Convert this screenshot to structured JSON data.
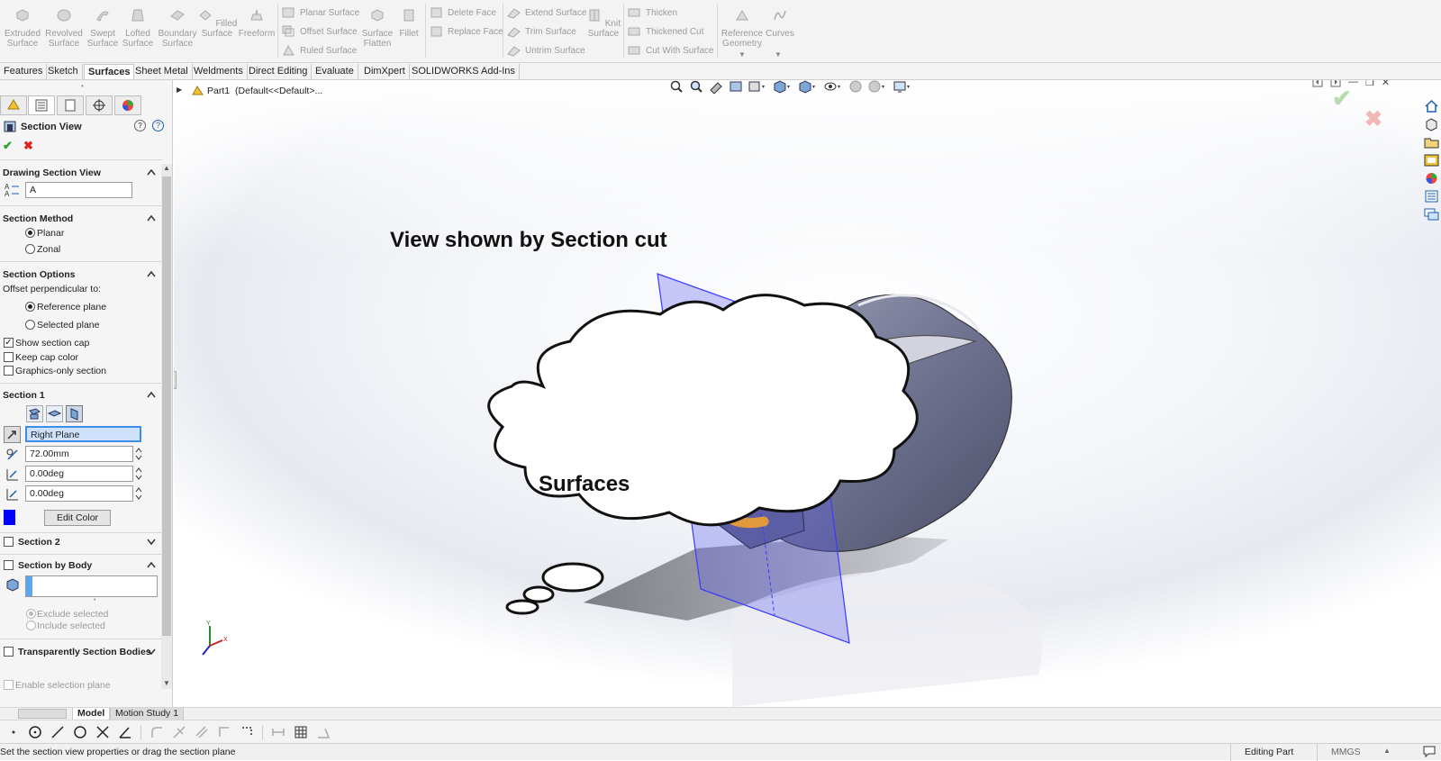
{
  "ribbon": {
    "big_buttons": [
      {
        "id": "extruded",
        "label": "Extruded Surface",
        "icon": "extruded-surface-icon"
      },
      {
        "id": "revolved",
        "label": "Revolved Surface",
        "icon": "revolved-surface-icon"
      },
      {
        "id": "swept",
        "label": "Swept Surface",
        "icon": "swept-surface-icon"
      },
      {
        "id": "lofted",
        "label": "Lofted Surface",
        "icon": "lofted-surface-icon"
      },
      {
        "id": "boundary",
        "label": "Boundary Surface",
        "icon": "boundary-surface-icon"
      },
      {
        "id": "filled",
        "label": "Filled Surface",
        "icon": "filled-surface-icon"
      },
      {
        "id": "freeform",
        "label": "Freeform",
        "icon": "freeform-icon"
      }
    ],
    "col1": [
      "Planar Surface",
      "Offset Surface",
      "Ruled Surface"
    ],
    "surface_flatten": "Surface Flatten",
    "fillet": "Fillet",
    "col2": [
      "Delete Face",
      "Replace Face"
    ],
    "col3": [
      "Extend Surface",
      "Trim Surface",
      "Untrim Surface"
    ],
    "knit_surface": "Knit Surface",
    "col4": [
      "Thicken",
      "Thickened Cut",
      "Cut With Surface"
    ],
    "reference_geometry": "Reference Geometry",
    "curves": "Curves"
  },
  "tabs": [
    "Features",
    "Sketch",
    "Surfaces",
    "Sheet Metal",
    "Weldments",
    "Direct Editing",
    "Evaluate",
    "DimXpert",
    "SOLIDWORKS Add-Ins"
  ],
  "active_tab": "Surfaces",
  "panel": {
    "title": "Section View",
    "drawing_section_view": {
      "header": "Drawing Section View",
      "label_value": "A"
    },
    "section_method": {
      "header": "Section Method",
      "options": [
        "Planar",
        "Zonal"
      ],
      "selected": "Planar"
    },
    "section_options": {
      "header": "Section Options",
      "offset_label": "Offset perpendicular to:",
      "options": [
        "Reference plane",
        "Selected plane"
      ],
      "selected": "Reference plane",
      "show_section_cap": "Show section cap",
      "keep_cap_color": "Keep cap color",
      "graphics_only": "Graphics-only section"
    },
    "section1": {
      "header": "Section 1",
      "plane": "Right Plane",
      "distance": "72.00mm",
      "angle_x": "0.00deg",
      "angle_y": "0.00deg",
      "edit_color": "Edit Color",
      "color": "#0000ff"
    },
    "section2": "Section 2",
    "section_by_body": {
      "header": "Section by Body",
      "options": [
        "Exclude selected",
        "Include selected"
      ]
    },
    "transparently": "Transparently Section Bodies",
    "enable_selection_plane": "Enable selection plane"
  },
  "tree": {
    "part": "Part1",
    "config": "(Default<<Default>..."
  },
  "viewport": {
    "annotation_title": "View shown by Section cut",
    "bubble_text": "Surfaces"
  },
  "bottom_tabs": [
    "Model",
    "Motion Study 1"
  ],
  "status": {
    "message": "Set the section view properties or drag the section plane",
    "mode": "Editing Part",
    "units": "MMGS"
  },
  "colors": {
    "accent_green": "#2aa52a",
    "cancel_red": "#d22",
    "plane_blue": "#3b3bff",
    "arrow_orange": "#f0a030"
  }
}
